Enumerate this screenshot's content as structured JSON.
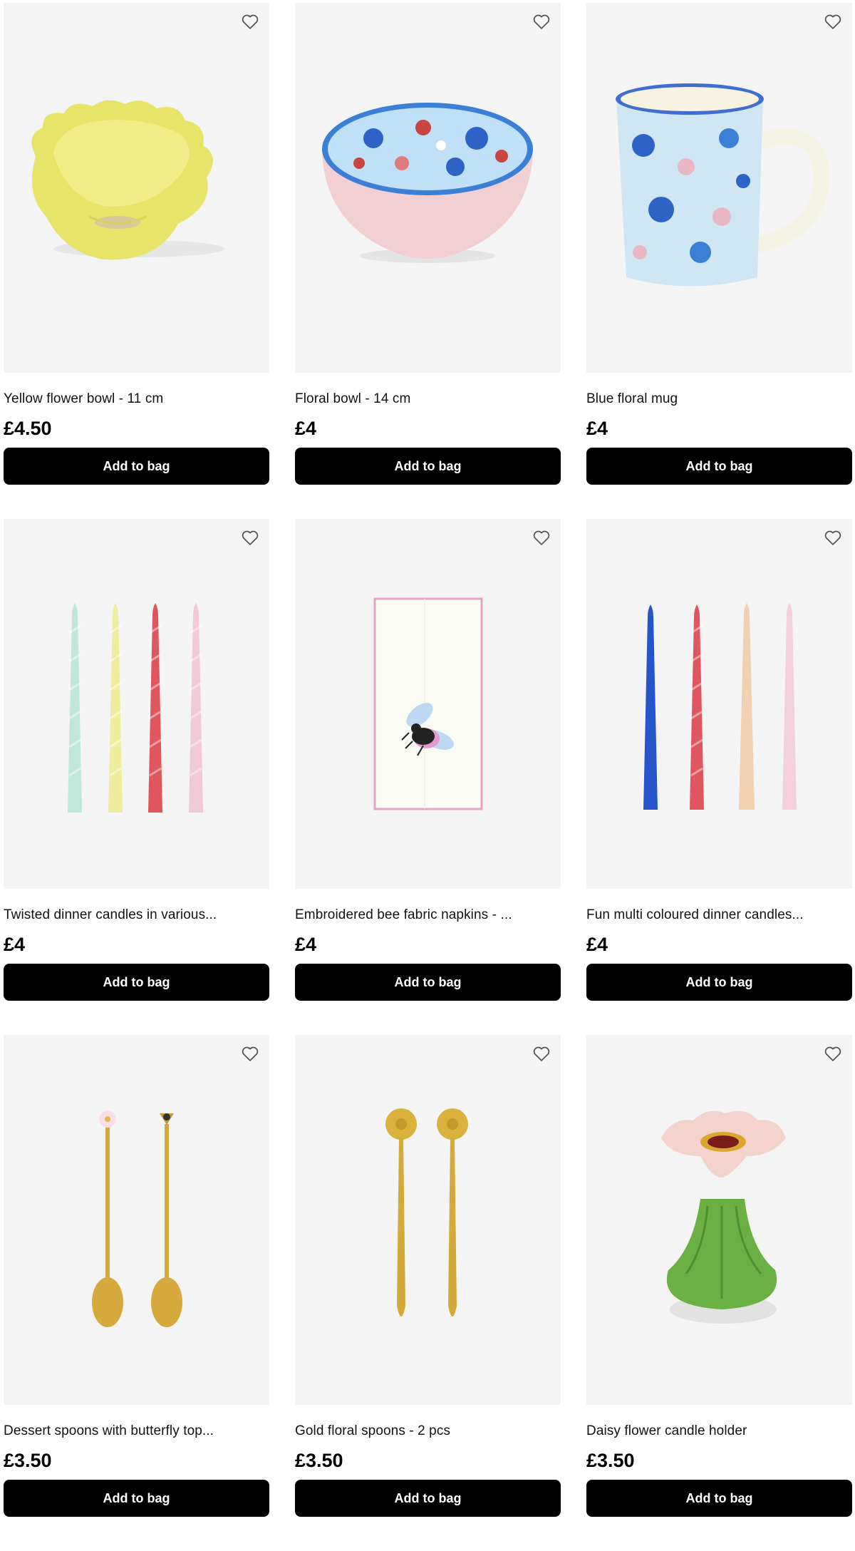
{
  "products": [
    {
      "name": "Yellow flower bowl - 11 cm",
      "price": "£4.50",
      "button": "Add to bag",
      "image": "yellow-flower-bowl"
    },
    {
      "name": "Floral bowl - 14 cm",
      "price": "£4",
      "button": "Add to bag",
      "image": "floral-bowl"
    },
    {
      "name": "Blue floral mug",
      "price": "£4",
      "button": "Add to bag",
      "image": "blue-floral-mug"
    },
    {
      "name": "Twisted dinner candles in various...",
      "price": "£4",
      "button": "Add to bag",
      "image": "twisted-candles"
    },
    {
      "name": "Embroidered bee fabric napkins - ...",
      "price": "£4",
      "button": "Add to bag",
      "image": "bee-napkin"
    },
    {
      "name": "Fun multi coloured dinner candles...",
      "price": "£4",
      "button": "Add to bag",
      "image": "multi-candles"
    },
    {
      "name": "Dessert spoons with butterfly top...",
      "price": "£3.50",
      "button": "Add to bag",
      "image": "dessert-spoons"
    },
    {
      "name": "Gold floral spoons - 2 pcs",
      "price": "£3.50",
      "button": "Add to bag",
      "image": "gold-floral-spoons"
    },
    {
      "name": "Daisy flower candle holder",
      "price": "£3.50",
      "button": "Add to bag",
      "image": "daisy-candle-holder"
    }
  ],
  "icons": {
    "favourite": "heart-outline-icon"
  },
  "colors": {
    "button_bg": "#000000",
    "button_text": "#ffffff",
    "image_bg": "#f4f4f4"
  }
}
